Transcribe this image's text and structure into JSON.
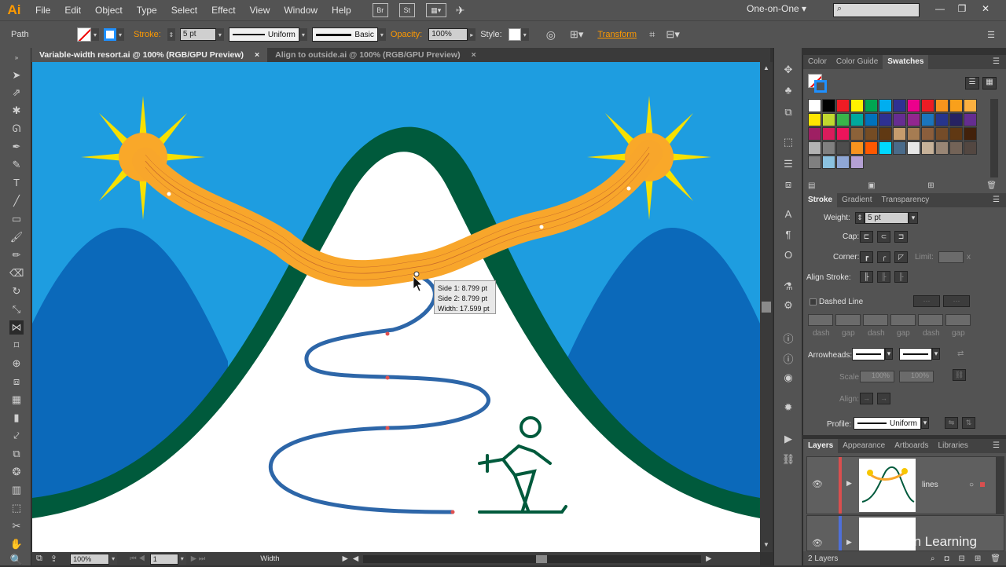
{
  "app": {
    "logo": "Ai",
    "workspace": "One-on-One",
    "window_controls": [
      "—",
      "❐",
      "✕"
    ]
  },
  "menu": [
    "File",
    "Edit",
    "Object",
    "Type",
    "Select",
    "Effect",
    "View",
    "Window",
    "Help"
  ],
  "menu_buttons": [
    "Br",
    "St"
  ],
  "control": {
    "selection": "Path",
    "stroke_label": "Stroke:",
    "stroke_weight": "5 pt",
    "profile": "Uniform",
    "brush": "Basic",
    "opacity_label": "Opacity:",
    "opacity": "100%",
    "style_label": "Style:",
    "transform": "Transform"
  },
  "tabs": [
    {
      "label": "Variable-width resort.ai @ 100% (RGB/GPU Preview)",
      "close": "×"
    },
    {
      "label": "Align to outside.ai @ 100% (RGB/GPU Preview)",
      "close": "×"
    }
  ],
  "tooltip": {
    "side1": "Side 1: 8.799 pt",
    "side2": "Side 2: 8.799 pt",
    "width": "Width:  17.599 pt"
  },
  "status": {
    "zoom": "100%",
    "artboard": "1",
    "tool": "Width"
  },
  "swatches_panel": {
    "tabs": [
      "Color",
      "Color Guide",
      "Swatches"
    ],
    "colors": [
      "#ffffff",
      "#000000",
      "#ee1c24",
      "#fff200",
      "#00a651",
      "#00aeef",
      "#2e3192",
      "#ec008c",
      "#ed1c24",
      "#f7941d",
      "#f9a01b",
      "#fbb040",
      "#ffe600",
      "#c1d82f",
      "#39b54a",
      "#00a99d",
      "#0072bc",
      "#2e3192",
      "#662d91",
      "#92278f",
      "#1b75bc",
      "#27358c",
      "#262262",
      "#652d90",
      "#9e1f63",
      "#d91c5c",
      "#ed145b",
      "#8c6239",
      "#754c24",
      "#603913",
      "#c69c6d",
      "#a67c52",
      "#8b5e3c",
      "#754c29",
      "#603813",
      "#42210b",
      "#b3b3b3",
      "#808080",
      "#4d4d4d",
      "#f7931e",
      "#ff5800",
      "#00d8ff",
      "#4a6b8a",
      "#e6e6e6",
      "#c7b299",
      "#998675",
      "#736357",
      "#534741",
      "#808080",
      "#8bc2e0",
      "#8fa7d6",
      "#b4a0d3"
    ]
  },
  "stroke_panel": {
    "tabs": [
      "Stroke",
      "Gradient",
      "Transparency"
    ],
    "weight_label": "Weight:",
    "weight": "5 pt",
    "cap_label": "Cap:",
    "corner_label": "Corner:",
    "limit_label": "Limit:",
    "limit_unit": "x",
    "align_label": "Align Stroke:",
    "dashed_label": "Dashed Line",
    "dash_labels": [
      "dash",
      "gap",
      "dash",
      "gap",
      "dash",
      "gap"
    ],
    "arrowheads_label": "Arrowheads:",
    "scale_label": "Scale:",
    "scale1": "100%",
    "scale2": "100%",
    "align2_label": "Align:",
    "profile_label": "Profile:",
    "profile": "Uniform"
  },
  "layers_panel": {
    "tabs": [
      "Layers",
      "Appearance",
      "Artboards",
      "Libraries"
    ],
    "layers": [
      {
        "name": "lines",
        "color": "#d94f4f"
      },
      {
        "name": "",
        "color": "#4f6fd9"
      }
    ],
    "count": "2 Layers"
  },
  "watermark": "Linked in Learning",
  "colors": {
    "sky": "#1e9de0",
    "mountain_small": "#0b69ba",
    "mountain_outline": "#005a3c",
    "sun": "#f9a829",
    "rays": "#f7e000",
    "path": "#2d66a8",
    "ribbon": "#f8a62b",
    "figure": "#005a3c",
    "accent": "#ff9a00"
  }
}
